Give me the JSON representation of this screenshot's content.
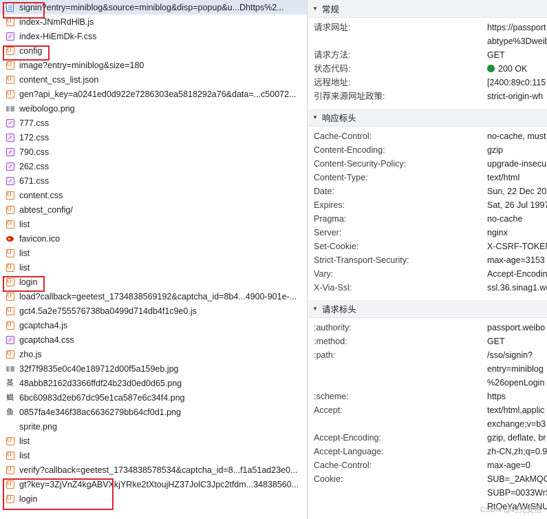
{
  "requests": [
    {
      "name": "signin?entry=miniblog&source=miniblog&disp=popup&u...Dhttps%2...",
      "type": "doc",
      "selected": true
    },
    {
      "name": "index-JNmRdHlB.js",
      "type": "js"
    },
    {
      "name": "index-HiEmDk-F.css",
      "type": "css"
    },
    {
      "name": "config",
      "type": "js"
    },
    {
      "name": "image?entry=miniblog&size=180",
      "type": "js"
    },
    {
      "name": "content_css_list.json",
      "type": "js"
    },
    {
      "name": "gen?api_key=a0241ed0d922e7286303ea5818292a76&data=...c50072...",
      "type": "js"
    },
    {
      "name": "weibologo.png",
      "type": "img"
    },
    {
      "name": "777.css",
      "type": "css"
    },
    {
      "name": "172.css",
      "type": "css"
    },
    {
      "name": "790.css",
      "type": "css"
    },
    {
      "name": "262.css",
      "type": "css"
    },
    {
      "name": "671.css",
      "type": "css"
    },
    {
      "name": "content.css",
      "type": "js"
    },
    {
      "name": "abtest_config/",
      "type": "js"
    },
    {
      "name": "list",
      "type": "js"
    },
    {
      "name": "favicon.ico",
      "type": "fav"
    },
    {
      "name": "list",
      "type": "js"
    },
    {
      "name": "list",
      "type": "js"
    },
    {
      "name": "login",
      "type": "js"
    },
    {
      "name": "load?callback=geetest_1734838569192&captcha_id=8b4...4900-901e-...",
      "type": "js"
    },
    {
      "name": "gct4.5a2e755576738ba0499d714db4f1c9e0.js",
      "type": "js"
    },
    {
      "name": "gcaptcha4.js",
      "type": "js"
    },
    {
      "name": "gcaptcha4.css",
      "type": "css"
    },
    {
      "name": "zho.js",
      "type": "js"
    },
    {
      "name": "32f7f9835e0c40e189712d00f5a159eb.jpg",
      "type": "img"
    },
    {
      "name": "48abb82162d3366ffdf24b23d0ed0d65.png",
      "type": "glyph",
      "glyph": "蒸"
    },
    {
      "name": "6bc60983d2eb67dc95e1ca587e6c34f4.png",
      "type": "glyph",
      "glyph": "蝎"
    },
    {
      "name": "0857fa4e346f38ac6636279bb64cf0d1.png",
      "type": "glyph",
      "glyph": "鱼"
    },
    {
      "name": "sprite.png",
      "type": "blank"
    },
    {
      "name": "list",
      "type": "js"
    },
    {
      "name": "list",
      "type": "js"
    },
    {
      "name": "verify?callback=geetest_1734838578534&captcha_id=8...f1a51ad23e0...",
      "type": "js"
    },
    {
      "name": "gt?key=3ZjVnZ4kgABVXkjYRke2tXtoujHZ37JolC3Jpc2tfdm...34838560...",
      "type": "js"
    },
    {
      "name": "login",
      "type": "js"
    }
  ],
  "icons": {
    "doc": "document-icon",
    "js": "script-icon",
    "css": "stylesheet-icon",
    "img": "image-icon",
    "fav": "favicon-icon",
    "glyph": "image-thumbnail-icon",
    "blank": "blank-icon"
  },
  "colors": {
    "highlight_box": "#d8262e",
    "status_ok": "#1e8e3e",
    "selected_row": "#dfe7f5"
  },
  "general": {
    "title": "常规",
    "rows": [
      {
        "key": "请求网址:",
        "value": [
          "https://passport",
          "abtype%3Dweib"
        ]
      },
      {
        "key": "请求方法:",
        "value": [
          "GET"
        ]
      },
      {
        "key": "状态代码:",
        "value": [
          "200 OK"
        ],
        "status": true
      },
      {
        "key": "远程地址:",
        "value": [
          "[2400:89c0:115"
        ]
      },
      {
        "key": "引荐来源网址政策:",
        "value": [
          "strict-origin-wh"
        ]
      }
    ]
  },
  "response_headers": {
    "title": "响应标头",
    "rows": [
      {
        "key": "Cache-Control:",
        "value": [
          "no-cache, must"
        ]
      },
      {
        "key": "Content-Encoding:",
        "value": [
          "gzip"
        ]
      },
      {
        "key": "Content-Security-Policy:",
        "value": [
          "upgrade-insecu"
        ]
      },
      {
        "key": "Content-Type:",
        "value": [
          "text/html"
        ]
      },
      {
        "key": "Date:",
        "value": [
          "Sun, 22 Dec 202"
        ]
      },
      {
        "key": "Expires:",
        "value": [
          "Sat, 26 Jul 1997"
        ]
      },
      {
        "key": "Pragma:",
        "value": [
          "no-cache"
        ]
      },
      {
        "key": "Server:",
        "value": [
          "nginx"
        ]
      },
      {
        "key": "Set-Cookie:",
        "value": [
          "X-CSRF-TOKEN"
        ]
      },
      {
        "key": "Strict-Transport-Security:",
        "value": [
          "max-age=3153"
        ]
      },
      {
        "key": "Vary:",
        "value": [
          "Accept-Encodin"
        ]
      },
      {
        "key": "X-Via-Ssl:",
        "value": [
          "ssl.36.sinag1.wo"
        ]
      }
    ]
  },
  "request_headers": {
    "title": "请求标头",
    "rows": [
      {
        "key": ":authority:",
        "value": [
          "passport.weibo"
        ]
      },
      {
        "key": ":method:",
        "value": [
          "GET"
        ]
      },
      {
        "key": ":path:",
        "value": [
          "/sso/signin?",
          "entry=miniblog",
          "%26openLogin"
        ]
      },
      {
        "key": ":scheme:",
        "value": [
          "https"
        ]
      },
      {
        "key": "Accept:",
        "value": [
          "text/html,applic",
          "exchange;v=b3"
        ]
      },
      {
        "key": "Accept-Encoding:",
        "value": [
          "gzip, deflate, br"
        ]
      },
      {
        "key": "Accept-Language:",
        "value": [
          "zh-CN,zh;q=0.9"
        ]
      },
      {
        "key": "Cache-Control:",
        "value": [
          "max-age=0"
        ]
      },
      {
        "key": "Cookie:",
        "value": [
          "SUB=_2AkMQC",
          "SUBP=0033WrS",
          "RtOeYa/WrSNUe"
        ]
      }
    ]
  },
  "watermark": "CSDN @时光安然"
}
